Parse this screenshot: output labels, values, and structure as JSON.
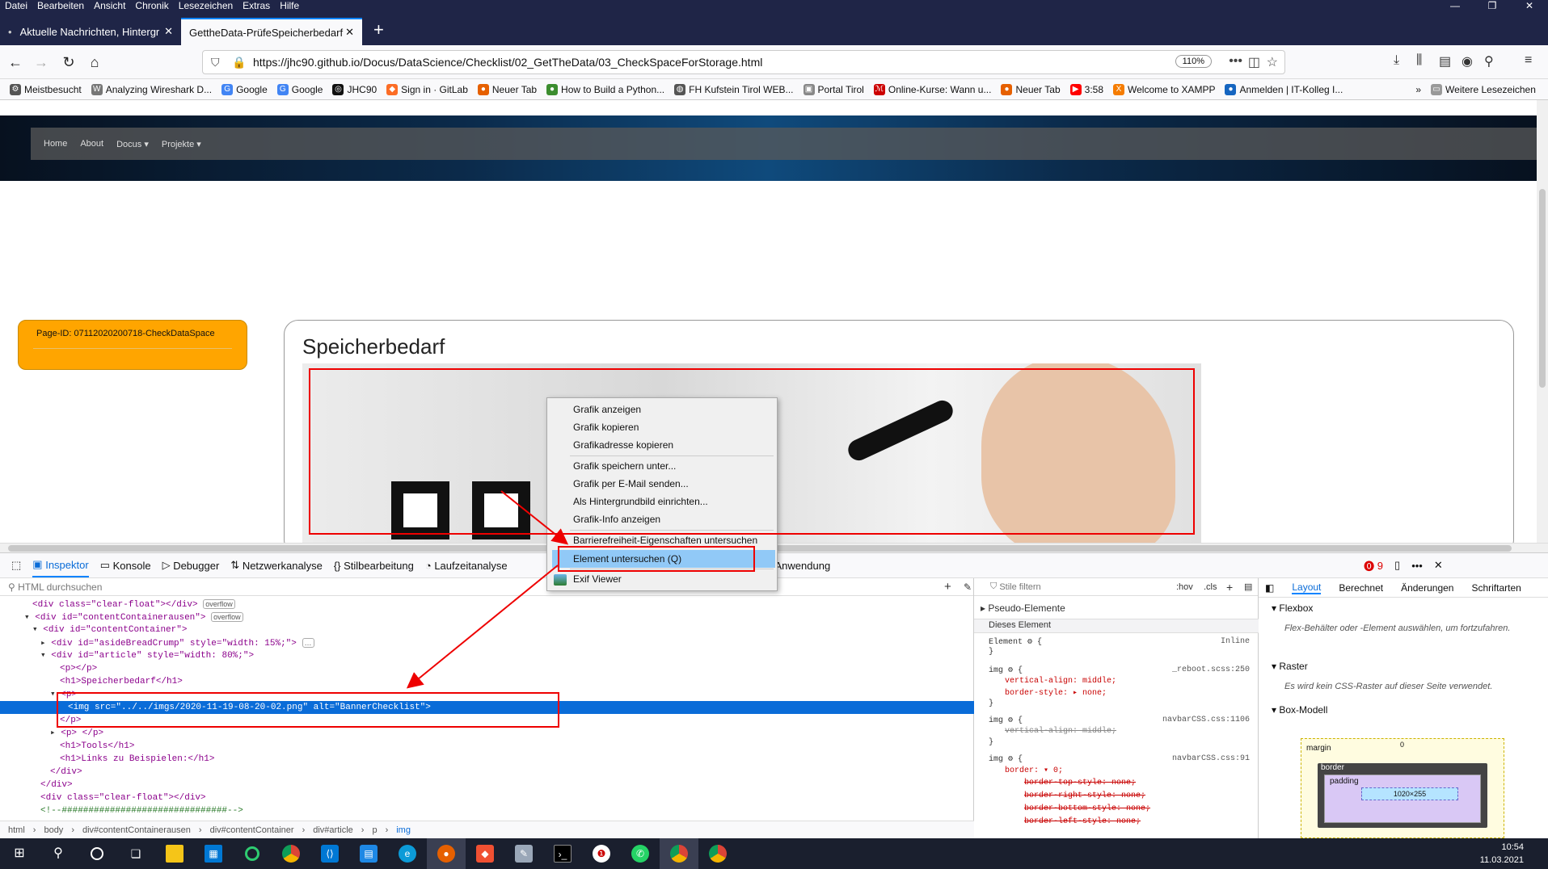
{
  "menubar": [
    "Datei",
    "Bearbeiten",
    "Ansicht",
    "Chronik",
    "Lesezeichen",
    "Extras",
    "Hilfe"
  ],
  "tabs": [
    {
      "label": "Aktuelle Nachrichten, Hintergr"
    },
    {
      "label": "GettheData-PrüfeSpeicherbedarf"
    }
  ],
  "url": "https://jhc90.github.io/Docus/DataScience/Checklist/02_GetTheData/03_CheckSpaceForStorage.html",
  "zoom": "110%",
  "bookmarks": [
    {
      "label": "Meistbesucht",
      "icon": "gear-icon",
      "color": "#555"
    },
    {
      "label": "Analyzing Wireshark D...",
      "icon": "wireshark-icon",
      "color": "#777"
    },
    {
      "label": "Google",
      "icon": "google-icon",
      "color": "#4285f4"
    },
    {
      "label": "Google",
      "icon": "google-icon",
      "color": "#4285f4"
    },
    {
      "label": "JHC90",
      "icon": "github-icon",
      "color": "#111"
    },
    {
      "label": "Sign in · GitLab",
      "icon": "gitlab-icon",
      "color": "#fc6d26"
    },
    {
      "label": "Neuer Tab",
      "icon": "firefox-icon",
      "color": "#e66000"
    },
    {
      "label": "How to Build a Python...",
      "icon": "python-icon",
      "color": "#3c8d2f"
    },
    {
      "label": "FH Kufstein Tirol WEB...",
      "icon": "globe-icon",
      "color": "#555"
    },
    {
      "label": "Portal Tirol",
      "icon": "portal-icon",
      "color": "#888"
    },
    {
      "label": "Online-Kurse: Wann u...",
      "icon": "course-icon",
      "color": "#c00"
    },
    {
      "label": "Neuer Tab",
      "icon": "firefox-icon",
      "color": "#e66000"
    },
    {
      "label": "3:58",
      "icon": "youtube-icon",
      "color": "#f00"
    },
    {
      "label": "Welcome to XAMPP",
      "icon": "xampp-icon",
      "color": "#f57c00"
    },
    {
      "label": "Anmelden | IT-Kolleg I...",
      "icon": "itkolleg-icon",
      "color": "#1565c0"
    }
  ],
  "bookmarks_more": "Weitere Lesezeichen",
  "site": {
    "nav": [
      "Home",
      "About",
      "Docus ▾",
      "Projekte ▾"
    ],
    "page_id": "Page-ID: 07112020200718-CheckDataSpace",
    "heading": "Speicherbedarf"
  },
  "context_menu": [
    "Grafik anzeigen",
    "Grafik kopieren",
    "Grafikadresse kopieren",
    "Grafik speichern unter...",
    "Grafik per E-Mail senden...",
    "Als Hintergrundbild einrichten...",
    "Grafik-Info anzeigen",
    "Barrierefreiheit-Eigenschaften untersuchen",
    "Element untersuchen (Q)",
    "Exif Viewer"
  ],
  "devtools": {
    "tabs": [
      "Inspektor",
      "Konsole",
      "Debugger",
      "Netzwerkanalyse",
      "Stilbearbeitung",
      "Laufzeitanalyse",
      "Anwendung"
    ],
    "error_count": "9",
    "html_search_placeholder": "HTML durchsuchen",
    "styles_filter_placeholder": "Stile filtern",
    "hov": ":hov",
    "cls": ".cls",
    "breadcrumb": [
      "html",
      "body",
      "div#contentContainerausen",
      "div#contentContainer",
      "div#article",
      "p",
      "img"
    ],
    "layout_tabs": [
      "Layout",
      "Berechnet",
      "Änderungen",
      "Schriftarten"
    ],
    "flexbox_title": "Flexbox",
    "flexbox_info": "Flex-Behälter oder -Element auswählen, um fortzufahren.",
    "raster_title": "Raster",
    "raster_info": "Es wird kein CSS-Raster auf dieser Seite verwendet.",
    "boxmodel_title": "Box-Modell",
    "boxmodel": {
      "margin": "margin",
      "border": "border",
      "padding": "padding",
      "content": "1020×255",
      "zero": "0"
    },
    "rules": {
      "pseudo": "Pseudo-Elemente",
      "this_element": "Dieses Element",
      "element_rule": "Element ⚙ {",
      "inline": "Inline",
      "img1": "img ⚙ {",
      "img1_src": "_reboot.scss:250",
      "img1_p1": "vertical-align: middle;",
      "img1_p2": "border-style: ▸ none;",
      "img2": "img ⚙ {",
      "img2_src": "navbarCSS.css:1106",
      "img2_p1": "vertical-align: middle;",
      "img3": "img ⚙ {",
      "img3_src": "navbarCSS.css:91",
      "img3_p1": "border: ▾ 0;",
      "img3_p2": "border-top-style: none;",
      "img3_p3": "border-right-style: none;",
      "img3_p4": "border-bottom-style: none;",
      "img3_p5": "border-left-style: none;",
      "close": "}"
    }
  },
  "html_tree": {
    "l1": "<div class=\"clear-float\"></div>",
    "l2": "<div id=\"contentContainerausen\">",
    "l3": "<div id=\"contentContainer\">",
    "l4": "<div id=\"asideBreadCrump\" style=\"width: 15%;\">",
    "l5": "<div id=\"article\" style=\"width: 80%;\">",
    "l6": "<p></p>",
    "l7": "<h1>Speicherbedarf</h1>",
    "l8": "<p>",
    "l9": "<img src=\"../../imgs/2020-11-19-08-20-02.png\" alt=\"BannerChecklist\">",
    "l10": "</p>",
    "l11": "<p> </p>",
    "l12": "<h1>Tools</h1>",
    "l13": "<h1>Links zu Beispielen:</h1>",
    "l14": "</div>",
    "l15": "</div>",
    "l16": "<div class=\"clear-float\"></div>",
    "l17": "<!--###############################-->",
    "badge_overflow": "overflow",
    "badge_dots": "…"
  },
  "clock": {
    "time": "10:54",
    "date": "11.03.2021"
  }
}
